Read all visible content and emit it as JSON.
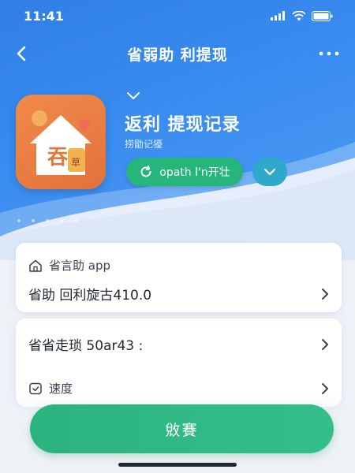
{
  "status_bar": {
    "time": "11:41"
  },
  "nav": {
    "title": "省弱助 利提现"
  },
  "app": {
    "icon_text": "吞",
    "icon_badge": "草",
    "title": "返利 提现记录",
    "subtitle": "捞勖记獶"
  },
  "update_button": {
    "label": "opath l'n开壮"
  },
  "card1": {
    "label": "省言助 app",
    "value": "省助 回利旋古410.0"
  },
  "card2": {
    "value": "省省走琐 50ar43 :",
    "speed_label": "速度"
  },
  "primary_button": {
    "label": "敓賽"
  },
  "colors": {
    "hero_blue": "#3a8cf0",
    "accent_green": "#26b57a",
    "icon_orange": "#e2723a"
  },
  "icons": [
    "back-icon",
    "more-icon",
    "signal-icon",
    "wifi-icon",
    "battery-icon",
    "refresh-icon",
    "chevron-down-icon",
    "home-icon",
    "chevron-right-icon",
    "clock-icon"
  ]
}
